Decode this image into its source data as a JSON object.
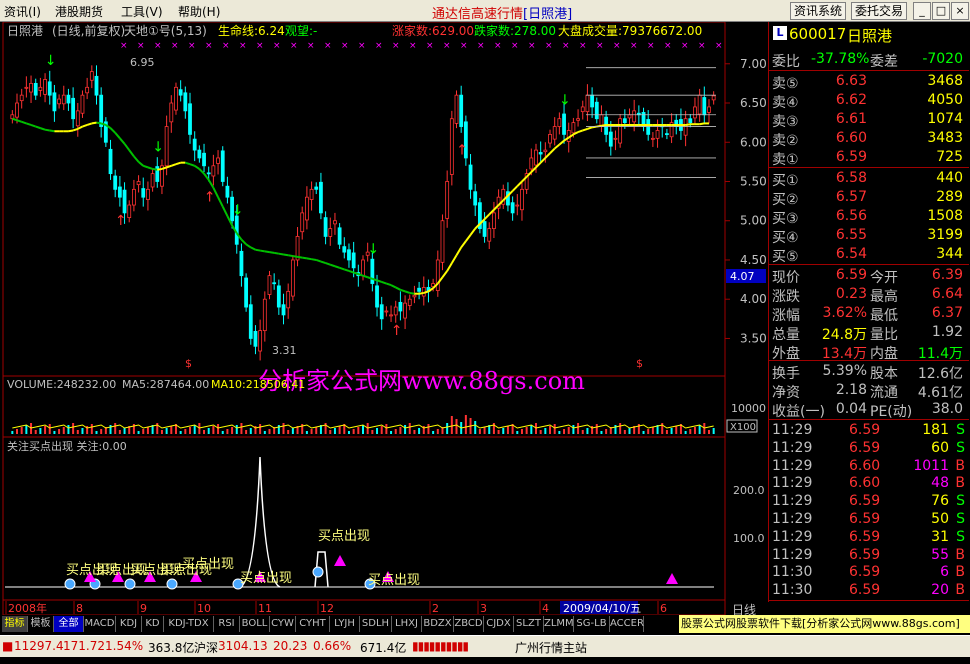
{
  "menu": {
    "items": [
      "资讯(I)",
      "港股期货",
      "工具(V)",
      "帮助(H)"
    ],
    "title": "通达信高速行情",
    "title_stock": "[日照港]",
    "btn_info": "资讯系统",
    "btn_trade": "委托交易",
    "win_buttons": [
      "_",
      "□",
      "×"
    ]
  },
  "chart_header": {
    "name": "日照港",
    "period": "(日线,前复权)",
    "indicator": "天地①号(5,13)",
    "lifeline": "生命线:6.24",
    "watch": "观望:-",
    "up_count": "涨家数:629.00",
    "down_count": "跌家数:278.00",
    "market_vol": "大盘成交量:79376672.00"
  },
  "chart_data": [
    {
      "type": "candlestick",
      "name": "price",
      "y_ticks": [
        "7.00",
        "6.50",
        "6.00",
        "5.50",
        "5.00",
        "4.50",
        "4.00",
        "3.50"
      ],
      "ylim": [
        3.2,
        7.15
      ],
      "annotations": [
        "6.95",
        "3.31"
      ],
      "current_price_tag": "4.07",
      "months": [
        "2008年",
        "8",
        "9",
        "10",
        "11",
        "12",
        "2",
        "3",
        "4",
        "5",
        "6"
      ],
      "date_highlight": "2009/04/10/五",
      "close": [
        6.35,
        6.5,
        6.6,
        6.7,
        6.75,
        6.6,
        6.7,
        6.8,
        6.6,
        6.4,
        6.55,
        6.6,
        6.5,
        6.3,
        6.4,
        6.6,
        6.7,
        6.9,
        6.6,
        6.2,
        6.0,
        5.6,
        5.4,
        5.3,
        5.1,
        5.2,
        5.4,
        5.5,
        5.3,
        5.4,
        5.6,
        5.5,
        5.7,
        6.2,
        6.5,
        6.7,
        6.6,
        6.4,
        6.1,
        5.9,
        5.8,
        5.7,
        5.6,
        5.7,
        5.8,
        5.5,
        5.3,
        5.0,
        4.7,
        4.3,
        3.9,
        3.5,
        3.4,
        3.6,
        4.0,
        4.3,
        4.2,
        3.9,
        3.8,
        4.1,
        4.5,
        4.8,
        5.1,
        5.3,
        5.4,
        5.4,
        5.1,
        4.8,
        4.9,
        5.0,
        4.7,
        4.6,
        4.5,
        4.4,
        4.3,
        4.5,
        4.6,
        4.2,
        3.9,
        3.75,
        3.85,
        3.8,
        3.9,
        3.85,
        3.95,
        4.0,
        4.05,
        4.1,
        4.15,
        4.1,
        4.2,
        4.5,
        5.0,
        5.5,
        6.3,
        6.6,
        6.2,
        5.8,
        5.4,
        5.2,
        4.9,
        4.8,
        4.9,
        5.1,
        5.3,
        5.4,
        5.2,
        5.1,
        5.2,
        5.4,
        5.6,
        5.8,
        5.9,
        5.85,
        5.9,
        6.1,
        6.2,
        6.3,
        6.1,
        6.15,
        6.25,
        6.3,
        6.45,
        6.6,
        6.45,
        6.3,
        6.35,
        6.1,
        5.95,
        6.05,
        6.3,
        6.25,
        6.35,
        6.4,
        6.35,
        6.2,
        6.1,
        6.05,
        6.15,
        6.2,
        6.1,
        6.25,
        6.2,
        6.15,
        6.3,
        6.25,
        6.45,
        6.6,
        6.35,
        6.45,
        6.59
      ],
      "ma_yellow": [
        6.3,
        6.28,
        6.26,
        6.24,
        6.22,
        6.2,
        6.18,
        6.16,
        6.15,
        6.14,
        6.14,
        6.14,
        6.14,
        6.15,
        6.17,
        6.2,
        6.22,
        6.24,
        6.25,
        6.24,
        6.22,
        6.18,
        6.12,
        6.05,
        5.98,
        5.9,
        5.82,
        5.75,
        5.7,
        5.68,
        5.66,
        5.65,
        5.66,
        5.68,
        5.7,
        5.72,
        5.74,
        5.74,
        5.72,
        5.7,
        5.66,
        5.6,
        5.52,
        5.42,
        5.3,
        5.18,
        5.06,
        4.94,
        4.84,
        4.76,
        4.7,
        4.66,
        4.63,
        4.62,
        4.61,
        4.6,
        4.59,
        4.58,
        4.57,
        4.56,
        4.55,
        4.54,
        4.53,
        4.52,
        4.51,
        4.5,
        4.48,
        4.46,
        4.44,
        4.42,
        4.4,
        4.38,
        4.36,
        4.34,
        4.32,
        4.3,
        4.28,
        4.26,
        4.24,
        4.22,
        4.2,
        4.18,
        4.15,
        4.12,
        4.1,
        4.08,
        4.07,
        4.07,
        4.08,
        4.1,
        4.14,
        4.2,
        4.28,
        4.36,
        4.46,
        4.56,
        4.66,
        4.74,
        4.82,
        4.9,
        4.96,
        5.02,
        5.08,
        5.14,
        5.2,
        5.26,
        5.32,
        5.38,
        5.44,
        5.5,
        5.56,
        5.62,
        5.68,
        5.74,
        5.8,
        5.86,
        5.92,
        5.97,
        6.02,
        6.06,
        6.1,
        6.13,
        6.15,
        6.17,
        6.19,
        6.2,
        6.21,
        6.22,
        6.22,
        6.22,
        6.22,
        6.22,
        6.22,
        6.22,
        6.22,
        6.22,
        6.22,
        6.22,
        6.22,
        6.22,
        6.22,
        6.22,
        6.22,
        6.22,
        6.22,
        6.23,
        6.23,
        6.23,
        6.24,
        6.24
      ],
      "ma_green_segments": "green while falling, yellow while rising"
    },
    {
      "type": "bar",
      "name": "volume",
      "label": "VOLUME:248232.00",
      "ma5": "MA5:287464.00",
      "ma10": "MA10:218506.41",
      "y_tick": "10000",
      "multiplier": "X100"
    },
    {
      "type": "line",
      "name": "buy_signal",
      "label": "关注买点出现 关注:0.00",
      "y_ticks": [
        "200.0",
        "100.0"
      ],
      "annotations": [
        "买点出现",
        "买点出现",
        "买点出现",
        "买点出现",
        "买点出现",
        "买点出现",
        "买点出现",
        "买点出现"
      ]
    }
  ],
  "watermark": "分析家公式网www.88gs.com",
  "right_panel": {
    "code": "600017",
    "name": "日照港",
    "ratio_label": "委比",
    "ratio": "-37.78%",
    "diff_label": "委差",
    "diff": "-7020",
    "asks": [
      {
        "label": "卖⑤",
        "price": "6.63",
        "vol": "3468"
      },
      {
        "label": "卖④",
        "price": "6.62",
        "vol": "4050"
      },
      {
        "label": "卖③",
        "price": "6.61",
        "vol": "1074"
      },
      {
        "label": "卖②",
        "price": "6.60",
        "vol": "3483"
      },
      {
        "label": "卖①",
        "price": "6.59",
        "vol": "725"
      }
    ],
    "bids": [
      {
        "label": "买①",
        "price": "6.58",
        "vol": "440"
      },
      {
        "label": "买②",
        "price": "6.57",
        "vol": "289"
      },
      {
        "label": "买③",
        "price": "6.56",
        "vol": "1508"
      },
      {
        "label": "买④",
        "price": "6.55",
        "vol": "3199"
      },
      {
        "label": "买⑤",
        "price": "6.54",
        "vol": "344"
      }
    ],
    "stats": [
      {
        "l1": "现价",
        "v1": "6.59",
        "l2": "今开",
        "v2": "6.39"
      },
      {
        "l1": "涨跌",
        "v1": "0.23",
        "l2": "最高",
        "v2": "6.64"
      },
      {
        "l1": "涨幅",
        "v1": "3.62%",
        "l2": "最低",
        "v2": "6.37"
      },
      {
        "l1": "总量",
        "v1": "24.8万",
        "l2": "量比",
        "v2": "1.92"
      },
      {
        "l1": "外盘",
        "v1": "13.4万",
        "l2": "内盘",
        "v2": "11.4万"
      }
    ],
    "stats2": [
      {
        "l1": "换手",
        "v1": "5.39%",
        "l2": "股本",
        "v2": "12.6亿"
      },
      {
        "l1": "净资",
        "v1": "2.18",
        "l2": "流通",
        "v2": "4.61亿"
      },
      {
        "l1": "收益(一)",
        "v1": "0.04",
        "l2": "PE(动)",
        "v2": "38.0"
      }
    ],
    "ticks": [
      {
        "time": "11:29",
        "price": "6.59",
        "vol": "181",
        "side": "S"
      },
      {
        "time": "11:29",
        "price": "6.59",
        "vol": "60",
        "side": "S"
      },
      {
        "time": "11:29",
        "price": "6.60",
        "vol": "1011",
        "side": "B"
      },
      {
        "time": "11:29",
        "price": "6.60",
        "vol": "48",
        "side": "B"
      },
      {
        "time": "11:29",
        "price": "6.59",
        "vol": "76",
        "side": "S"
      },
      {
        "time": "11:29",
        "price": "6.59",
        "vol": "50",
        "side": "S"
      },
      {
        "time": "11:29",
        "price": "6.59",
        "vol": "31",
        "side": "S"
      },
      {
        "time": "11:29",
        "price": "6.59",
        "vol": "55",
        "side": "B"
      },
      {
        "time": "11:30",
        "price": "6.59",
        "vol": "6",
        "side": "B"
      },
      {
        "time": "11:30",
        "price": "6.59",
        "vol": "20",
        "side": "B"
      }
    ],
    "period_label": "日线"
  },
  "tabs": [
    "指标",
    "模板",
    "全部",
    "MACD",
    "KDJ",
    "KD",
    "KDJ-TDX",
    "RSI",
    "BOLL",
    "CYW",
    "CYHT",
    "LYJH",
    "SDLH",
    "LHXJ",
    "BDZX",
    "ZBCD",
    "CJDX",
    "SLZT",
    "ZLMM",
    "SG-LB",
    "ACCER"
  ],
  "marquee": "股票公式网股票软件下载[分析家公式网www.88gs.com]",
  "status": {
    "sh_index": "11297.4",
    "sh_chg": "171.72",
    "sh_pct": "1.54%",
    "sh_amt": "363.8亿",
    "hs_label": "沪深",
    "hs_index": "3104.13",
    "hs_chg": "20.23",
    "hs_pct": "0.66%",
    "hs_amt": "671.4亿",
    "station": "广州行情主站"
  },
  "colors": {
    "up": "#ff3232",
    "down": "#00ffff",
    "ma_rise": "#ffff00",
    "ma_fall": "#00c000",
    "accent": "#ff00ff"
  }
}
